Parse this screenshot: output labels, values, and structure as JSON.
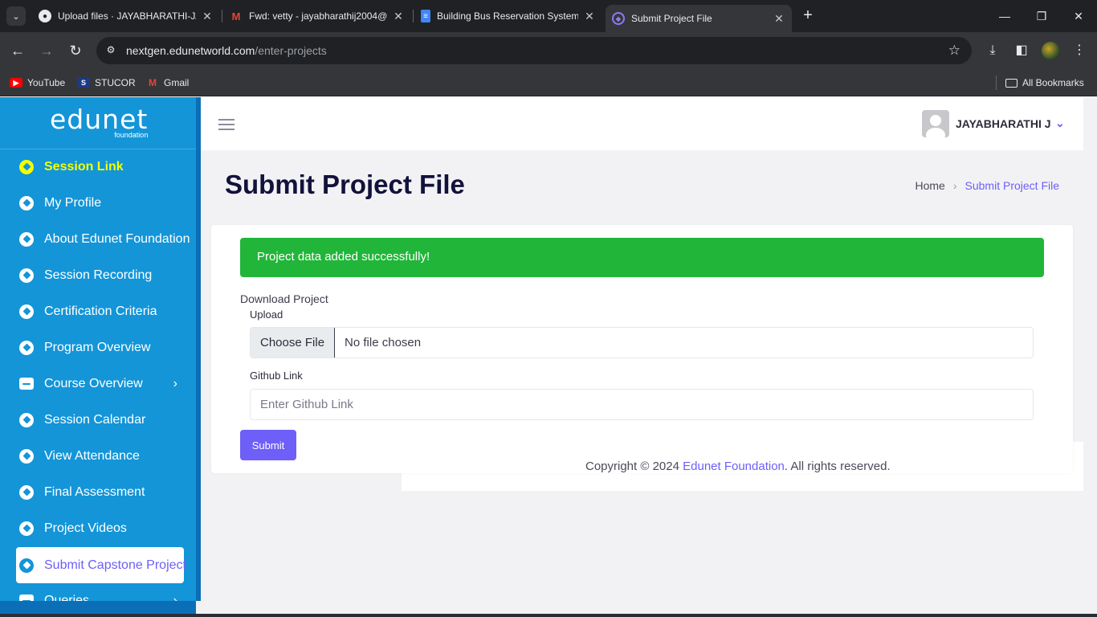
{
  "browser": {
    "tabs": [
      {
        "title": "Upload files · JAYABHARATHI-J/"
      },
      {
        "title": "Fwd: vetty - jayabharathij2004@"
      },
      {
        "title": "Building Bus Reservation System"
      },
      {
        "title": "Submit Project File"
      }
    ],
    "url_host": "nextgen.edunetworld.com",
    "url_path": "/enter-projects",
    "bookmarks": [
      "YouTube",
      "STUCOR",
      "Gmail"
    ],
    "all_bookmarks": "All Bookmarks"
  },
  "sidebar": {
    "logo": "edunet",
    "logo_sub": "foundation",
    "items": [
      {
        "label": "Session Link"
      },
      {
        "label": "My Profile"
      },
      {
        "label": "About Edunet Foundation"
      },
      {
        "label": "Session Recording"
      },
      {
        "label": "Certification Criteria"
      },
      {
        "label": "Program Overview"
      },
      {
        "label": "Course Overview"
      },
      {
        "label": "Session Calendar"
      },
      {
        "label": "View Attendance"
      },
      {
        "label": "Final Assessment"
      },
      {
        "label": "Project Videos"
      },
      {
        "label": "Submit Capstone Project"
      },
      {
        "label": "Queries"
      }
    ]
  },
  "header": {
    "user_name": "JAYABHARATHI J"
  },
  "main": {
    "title": "Submit Project File",
    "breadcrumb": {
      "home": "Home",
      "current": "Submit Project File"
    },
    "alert": "Project data added successfully!",
    "section_label": "Download Project",
    "upload_label": "Upload",
    "choose_file": "Choose File",
    "no_file": "No file chosen",
    "github_label": "Github Link",
    "github_placeholder": "Enter Github Link",
    "submit": "Submit"
  },
  "footer": {
    "prefix": "Copyright © 2024 ",
    "link": "Edunet Foundation",
    "suffix": ". All rights reserved."
  },
  "colors": {
    "sidebar": "#1395d8",
    "accent": "#6d5ff7",
    "success": "#21b639",
    "highlight": "#f2ff00"
  }
}
